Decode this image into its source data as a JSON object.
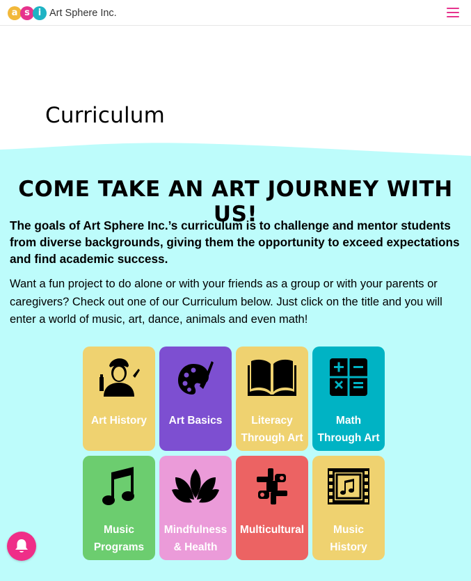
{
  "header": {
    "logo_letters": [
      "a",
      "s",
      "i"
    ],
    "logo_colors": [
      "#f2b83a",
      "#e6338d",
      "#1fb3c4"
    ],
    "logo_text": "Art Sphere Inc.",
    "menu_icon": "hamburger-icon"
  },
  "hero": {
    "title": "Curriculum"
  },
  "main": {
    "heading": "COME TAKE AN ART JOURNEY WITH US!",
    "lead": "The goals of Art Sphere Inc.’s curriculum is to challenge and mentor students from diverse backgrounds, giving them the opportunity to exceed expectations and find academic success.",
    "body": "Want a fun project to do alone or with your friends as a group or with your parents or caregivers? Check out one of our Curriculum below. Just click on the title and you will enter a world of music, art, dance, animals and even math!"
  },
  "cards": [
    {
      "label": "Art History",
      "color": "#efd270",
      "icon": "artist-icon"
    },
    {
      "label": "Art Basics",
      "color": "#7d4fd1",
      "icon": "palette-icon"
    },
    {
      "label": "Literacy Through Art",
      "color": "#efd270",
      "icon": "book-icon"
    },
    {
      "label": "Math Through Art",
      "color": "#00b3c4",
      "icon": "calculator-icon"
    },
    {
      "label": "Music Programs",
      "color": "#6ccd6f",
      "icon": "music-note-icon"
    },
    {
      "label": "Mindfulness & Health",
      "color": "#eb9bd9",
      "icon": "lotus-icon"
    },
    {
      "label": "Multicultural",
      "color": "#ec6363",
      "icon": "hands-icon"
    },
    {
      "label": "Music History",
      "color": "#efd270",
      "icon": "film-music-icon"
    }
  ],
  "notification": {
    "icon": "bell-icon",
    "color": "#ef2e88"
  }
}
